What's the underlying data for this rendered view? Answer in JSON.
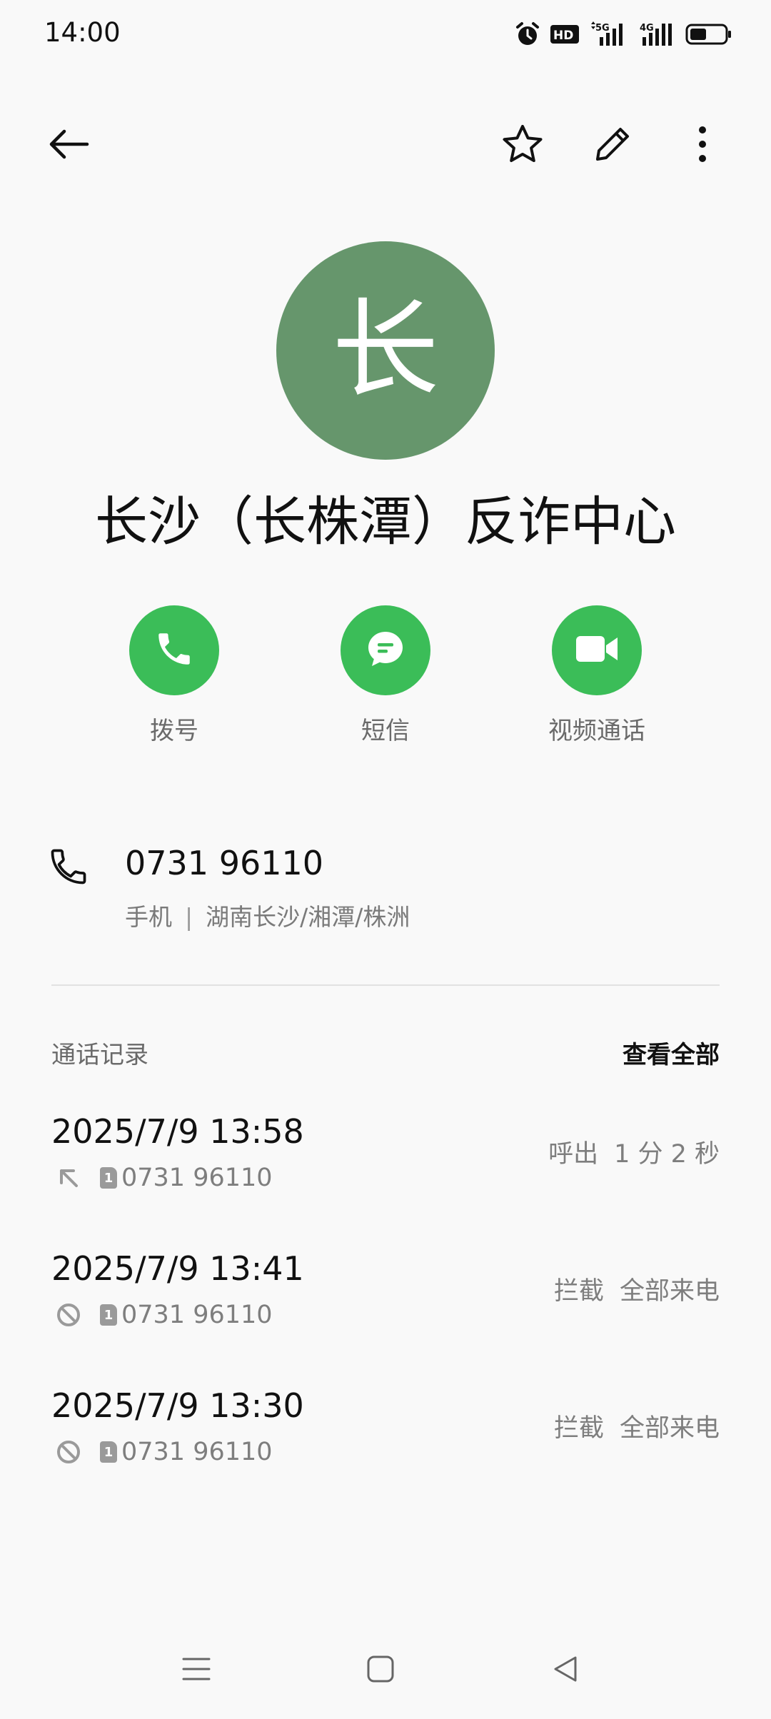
{
  "status_bar": {
    "time": "14:00",
    "icons": [
      "alarm-icon",
      "hd-icon",
      "5g-signal-icon",
      "4g-signal-icon",
      "battery-icon"
    ],
    "hd_text": "HD",
    "net1": "5G",
    "net2": "4G"
  },
  "app_bar": {
    "icons": [
      "back-arrow-icon",
      "star-icon",
      "edit-pencil-icon",
      "more-vertical-icon"
    ]
  },
  "contact": {
    "avatar_letter": "长",
    "avatar_color": "#66966c",
    "name": "长沙（长株潭）反诈中心"
  },
  "actions": [
    {
      "label": "拨号",
      "icon": "phone-icon"
    },
    {
      "label": "短信",
      "icon": "message-icon"
    },
    {
      "label": "视频通话",
      "icon": "video-camera-icon"
    }
  ],
  "accent_color": "#3bbd58",
  "phone": {
    "number": "0731 96110",
    "type": "手机",
    "separator": "|",
    "location": "湖南长沙/湘潭/株洲"
  },
  "history": {
    "title": "通话记录",
    "view_all": "查看全部",
    "items": [
      {
        "datetime": "2025/7/9 13:58",
        "type_icon": "outgoing-call-arrow-icon",
        "sim": "1",
        "number": "0731 96110",
        "status": "呼出",
        "detail": "1 分 2 秒"
      },
      {
        "datetime": "2025/7/9 13:41",
        "type_icon": "blocked-icon",
        "sim": "1",
        "number": "0731 96110",
        "status": "拦截",
        "detail": "全部来电"
      },
      {
        "datetime": "2025/7/9 13:30",
        "type_icon": "blocked-icon",
        "sim": "1",
        "number": "0731 96110",
        "status": "拦截",
        "detail": "全部来电"
      }
    ]
  },
  "nav_bar": {
    "icons": [
      "menu-lines-icon",
      "home-square-icon",
      "back-triangle-icon"
    ]
  }
}
